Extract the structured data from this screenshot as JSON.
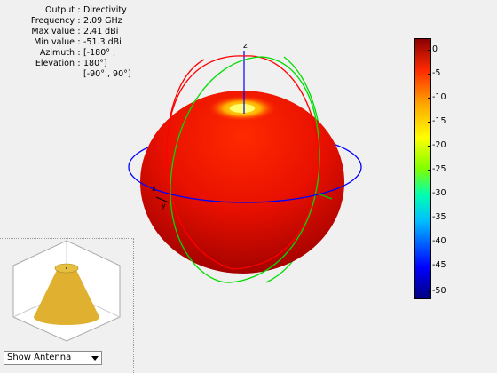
{
  "info": {
    "rows": [
      {
        "label": "Output",
        "value": "Directivity"
      },
      {
        "label": "Frequency",
        "value": "2.09 GHz"
      },
      {
        "label": "Max value",
        "value": "2.41 dBi"
      },
      {
        "label": "Min value",
        "value": "-51.3 dBi"
      },
      {
        "label": "Azimuth",
        "value": "[-180° ,"
      },
      {
        "label": "Elevation",
        "value": "180°]"
      }
    ],
    "extra": "[-90° , 90°]",
    "separator": ":"
  },
  "plot": {
    "axis_labels": {
      "z": "z",
      "x": "x",
      "y": "y"
    }
  },
  "colorbar": {
    "ticks": [
      "0",
      "-5",
      "-10",
      "-15",
      "-20",
      "-25",
      "-30",
      "-35",
      "-40",
      "-45",
      "-50"
    ]
  },
  "antenna_view": {
    "dropdown_value": "Show Antenna"
  },
  "colors": {
    "pattern_red": "#e60000",
    "pattern_top": "#ffff40",
    "circle_red": "#ff0000",
    "circle_green": "#00dd00",
    "circle_blue": "#0000ff",
    "antenna_gold": "#e0b030"
  }
}
